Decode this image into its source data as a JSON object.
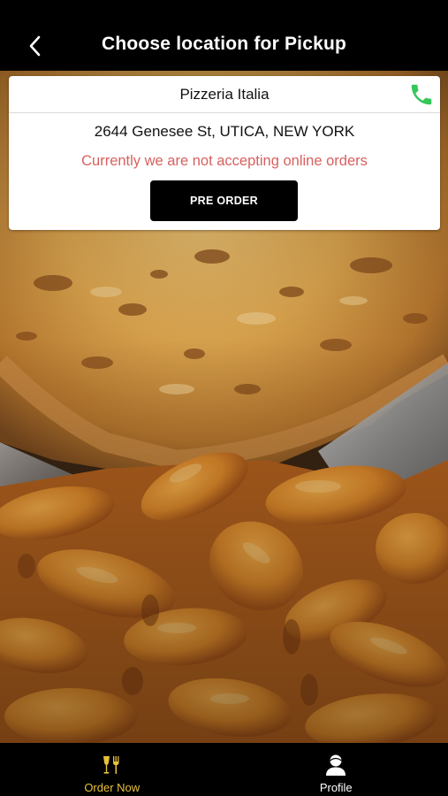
{
  "header": {
    "title": "Choose location for Pickup",
    "back_icon": "chevron-left-icon"
  },
  "location": {
    "name": "Pizzeria Italia",
    "address": "2644 Genesee St, UTICA, NEW YORK",
    "status": "Currently we are not accepting online orders",
    "preorder_label": "PRE ORDER",
    "phone_icon": "phone-icon"
  },
  "background": {
    "image": "pizza-and-buffalo-wings-photo"
  },
  "tabbar": {
    "tabs": [
      {
        "label": "Order Now",
        "icon": "fork-knife-icon",
        "active": true
      },
      {
        "label": "Profile",
        "icon": "person-icon",
        "active": false
      }
    ]
  },
  "colors": {
    "status_text": "#d8605f",
    "active_tab": "#e8c13a",
    "phone_green": "#34c759",
    "header_bg": "#000000"
  }
}
